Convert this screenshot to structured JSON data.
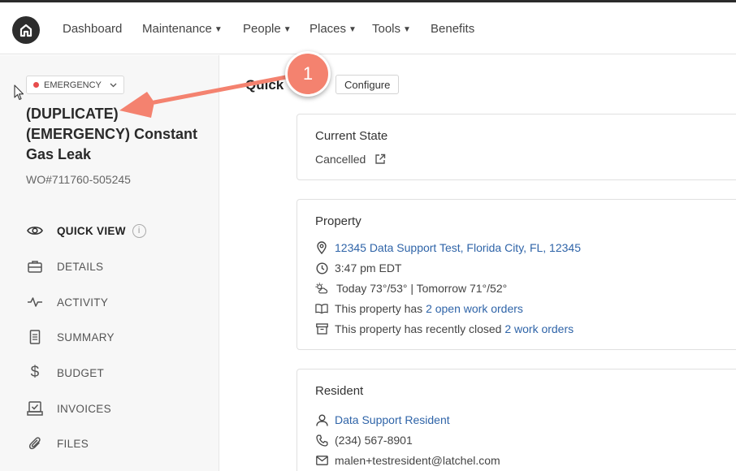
{
  "nav": {
    "items": [
      {
        "label": "Dashboard",
        "has_caret": false
      },
      {
        "label": "Maintenance",
        "has_caret": true
      },
      {
        "label": "People",
        "has_caret": true
      },
      {
        "label": "Places",
        "has_caret": true
      },
      {
        "label": "Tools",
        "has_caret": true
      },
      {
        "label": "Benefits",
        "has_caret": false
      }
    ],
    "logo_icon": "home-logo-icon"
  },
  "sidebar": {
    "badge_label": "EMERGENCY",
    "badge_color": "#e74c4c",
    "title_lines": [
      "(DUPLICATE)",
      "(EMERGENCY) Constant",
      "Gas Leak"
    ],
    "wo_number": "WO#711760-505245",
    "menu": [
      {
        "label": "QUICK VIEW",
        "icon": "eye-icon",
        "active": true
      },
      {
        "label": "DETAILS",
        "icon": "briefcase-icon",
        "active": false
      },
      {
        "label": "ACTIVITY",
        "icon": "pulse-icon",
        "active": false
      },
      {
        "label": "SUMMARY",
        "icon": "document-icon",
        "active": false
      },
      {
        "label": "BUDGET",
        "icon": "dollar-icon",
        "active": false
      },
      {
        "label": "INVOICES",
        "icon": "invoice-icon",
        "active": false
      },
      {
        "label": "FILES",
        "icon": "paperclip-icon",
        "active": false
      }
    ]
  },
  "main": {
    "heading": "Quick",
    "configure_label": "Configure",
    "current_state": {
      "title": "Current State",
      "value": "Cancelled"
    },
    "property": {
      "title": "Property",
      "address": "12345 Data Support Test, Florida City, FL, 12345",
      "time": "3:47 pm EDT",
      "weather": "Today 73°/53° | Tomorrow 71°/52°",
      "open_prefix": "This property has ",
      "open_link": "2 open work orders",
      "closed_prefix": "This property has recently closed ",
      "closed_link": "2 work orders"
    },
    "resident": {
      "title": "Resident",
      "name": "Data Support Resident",
      "phone": "(234) 567-8901",
      "email": "malen+testresident@latchel.com"
    }
  },
  "annotation": {
    "step_number": "1",
    "color": "#f4826f"
  },
  "colors": {
    "link": "#2f64a8",
    "accent": "#f4826f"
  }
}
